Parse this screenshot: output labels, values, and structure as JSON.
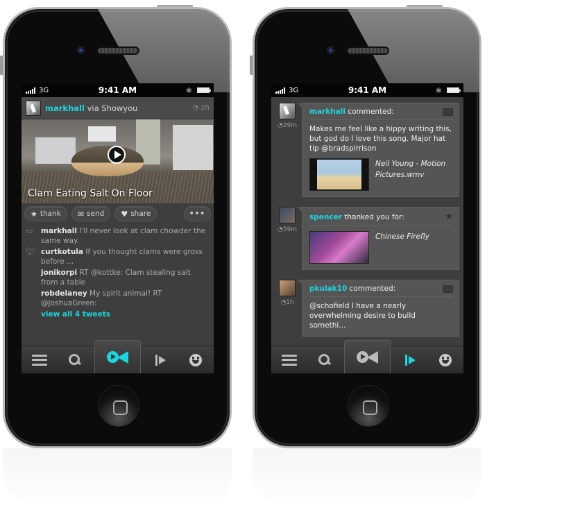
{
  "status_bar": {
    "carrier": "3G",
    "time": "9:41 AM"
  },
  "left_screen": {
    "post": {
      "username": "markhall",
      "via": "via Showyou",
      "age": "2h",
      "video_title": "Clam Eating Salt On Floor"
    },
    "actions": [
      {
        "label": "thank",
        "icon": "star-icon"
      },
      {
        "label": "send",
        "icon": "envelope-icon"
      },
      {
        "label": "share",
        "icon": "heart-icon"
      },
      {
        "label": "•••",
        "icon": "more-icon"
      }
    ],
    "tweets": [
      {
        "source": "comment",
        "user": "markhall",
        "text": "I'll never look at clam chowder the same way."
      },
      {
        "source": "twitter",
        "user": "curtkotula",
        "text": "If you thought clams were gross before ..."
      },
      {
        "source": "twitter",
        "user": "jonikorpi",
        "text": "RT @kottke: Clam stealing salt from a table"
      },
      {
        "source": "twitter",
        "user": "robdelaney",
        "text": "My spirit animal! RT @JoshuaGreen:"
      }
    ],
    "view_all": "view all 4 tweets",
    "active_tab": "home"
  },
  "right_screen": {
    "notifications": [
      {
        "user": "markhall",
        "action": "commented:",
        "age": "29m",
        "icon": "comment-icon",
        "body": "Makes me feel like a hippy writing this, but god do I love this song. Major hat tip @bradspirrison",
        "media_title": "Neil Young - Motion Pictures.wmv"
      },
      {
        "user": "spencer",
        "action": "thanked you for:",
        "age": "59m",
        "icon": "star-icon",
        "body": "",
        "media_title": "Chinese Firefly"
      },
      {
        "user": "pkulak10",
        "action": "commented:",
        "age": "1h",
        "icon": "comment-icon",
        "body": "@schofield I have a nearly overwhelming desire to build somethi...",
        "media_title": ""
      }
    ],
    "active_tab": "activity"
  },
  "tabbar": {
    "tabs": [
      "menu",
      "search",
      "home",
      "activity",
      "profile"
    ]
  },
  "colors": {
    "accent": "#1ed4e0",
    "inactive": "#bbbbbb"
  }
}
